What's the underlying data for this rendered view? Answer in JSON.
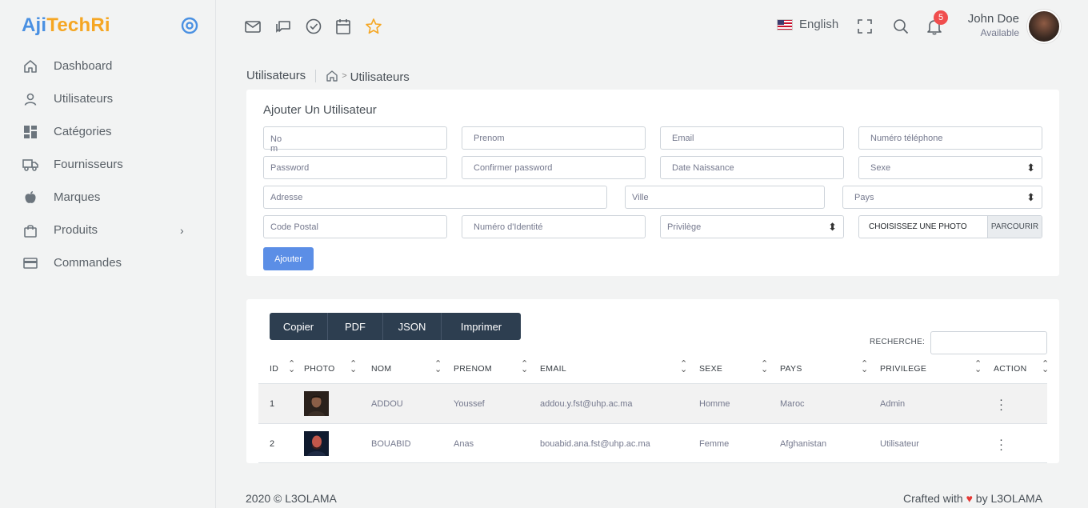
{
  "app": {
    "logo_part1": "Aji",
    "logo_part2": "TechRi"
  },
  "sidebar": {
    "items": [
      {
        "label": "Dashboard",
        "icon": "home-icon"
      },
      {
        "label": "Utilisateurs",
        "icon": "user-icon"
      },
      {
        "label": "Catégories",
        "icon": "grid-icon"
      },
      {
        "label": "Fournisseurs",
        "icon": "truck-icon"
      },
      {
        "label": "Marques",
        "icon": "apple-icon"
      },
      {
        "label": "Produits",
        "icon": "bag-icon",
        "chevron": "›"
      },
      {
        "label": "Commandes",
        "icon": "card-icon"
      }
    ]
  },
  "topbar": {
    "language": "English",
    "notification_count": "5",
    "user_name": "John Doe",
    "user_status": "Available"
  },
  "breadcrumb": {
    "title": "Utilisateurs",
    "gt": ">",
    "current": "Utilisateurs"
  },
  "form": {
    "title": "Ajouter Un Utilisateur",
    "nom_line1": "No",
    "nom_line2": "m",
    "prenom": "Prenom",
    "email": "Email",
    "telephone": "Numéro téléphone",
    "password": "Password",
    "confirm_password": "Confirmer password",
    "date_naissance": "Date Naissance",
    "sexe": "Sexe",
    "adresse": "Adresse",
    "ville": "Ville",
    "pays": "Pays",
    "code_postal": "Code Postal",
    "numero_identite": "Numéro d'Identité",
    "privilege": "Privilège",
    "photo_placeholder": "CHOISISSEZ UNE PHOTO",
    "browse_label": "PARCOURIR",
    "submit_label": "Ajouter"
  },
  "table": {
    "buttons": [
      "Copier",
      "PDF",
      "JSON",
      "Imprimer"
    ],
    "search_label": "RECHERCHE:",
    "columns": [
      "ID",
      "PHOTO",
      "NOM",
      "PRENOM",
      "EMAIL",
      "SEXE",
      "PAYS",
      "PRIVILEGE",
      "ACTION"
    ],
    "rows": [
      {
        "id": "1",
        "nom": "ADDOU",
        "prenom": "Youssef",
        "email": "addou.y.fst@uhp.ac.ma",
        "sexe": "Homme",
        "pays": "Maroc",
        "privilege": "Admin"
      },
      {
        "id": "2",
        "nom": "BOUABID",
        "prenom": "Anas",
        "email": "bouabid.ana.fst@uhp.ac.ma",
        "sexe": "Femme",
        "pays": "Afghanistan",
        "privilege": "Utilisateur"
      }
    ]
  },
  "footer": {
    "left": "2020 © L3OLAMA",
    "right_prefix": "Crafted with",
    "heart": "♥",
    "right_suffix": "by L3OLAMA"
  },
  "colors": {
    "accent": "#4a90e2",
    "logo_orange": "#f5a623",
    "button_dark": "#2d3e50",
    "button_primary": "#5b8ee6",
    "badge_red": "#f04d4d"
  }
}
